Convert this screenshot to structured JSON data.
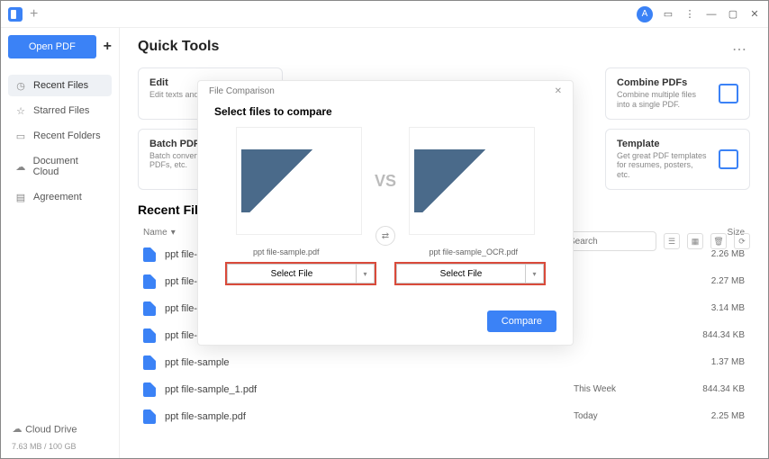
{
  "titlebar": {
    "avatar_letter": "A"
  },
  "sidebar": {
    "open_label": "Open PDF",
    "items": [
      {
        "label": "Recent Files"
      },
      {
        "label": "Starred Files"
      },
      {
        "label": "Recent Folders"
      },
      {
        "label": "Document Cloud"
      },
      {
        "label": "Agreement"
      }
    ],
    "cloud_label": "Cloud Drive",
    "storage": "7.63 MB / 100 GB"
  },
  "main": {
    "title": "Quick Tools",
    "cards_row1": [
      {
        "title": "Edit",
        "desc": "Edit texts and images of a file."
      },
      {
        "title": "",
        "desc": ""
      },
      {
        "title": "",
        "desc": ""
      },
      {
        "title": "Combine PDFs",
        "desc": "Combine multiple files into a single PDF."
      }
    ],
    "cards_row2": [
      {
        "title": "Batch PDFs",
        "desc": "Batch convert, create, print, OCR PDFs, etc."
      },
      {
        "title": "",
        "desc": ""
      },
      {
        "title": "",
        "desc": ""
      },
      {
        "title": "Template",
        "desc": "Get great PDF templates for resumes, posters, etc."
      }
    ],
    "recent_title": "Recent Files",
    "search_placeholder": "Search",
    "columns": {
      "name": "Name",
      "size": "Size"
    },
    "files": [
      {
        "name": "ppt file-sample",
        "date": "",
        "size": "2.26 MB"
      },
      {
        "name": "ppt file-sample",
        "date": "",
        "size": "2.27 MB"
      },
      {
        "name": "ppt file-sample",
        "date": "",
        "size": "3.14 MB"
      },
      {
        "name": "ppt file-sample",
        "date": "",
        "size": "844.34 KB"
      },
      {
        "name": "ppt file-sample",
        "date": "",
        "size": "1.37 MB"
      },
      {
        "name": "ppt file-sample_1.pdf",
        "date": "This Week",
        "size": "844.34 KB"
      },
      {
        "name": "ppt file-sample.pdf",
        "date": "Today",
        "size": "2.25 MB"
      }
    ]
  },
  "modal": {
    "head": "File Comparison",
    "title": "Select files to compare",
    "vs": "VS",
    "file_left": "ppt file-sample.pdf",
    "file_right": "ppt file-sample_OCR.pdf",
    "select_label": "Select File",
    "compare_label": "Compare"
  }
}
